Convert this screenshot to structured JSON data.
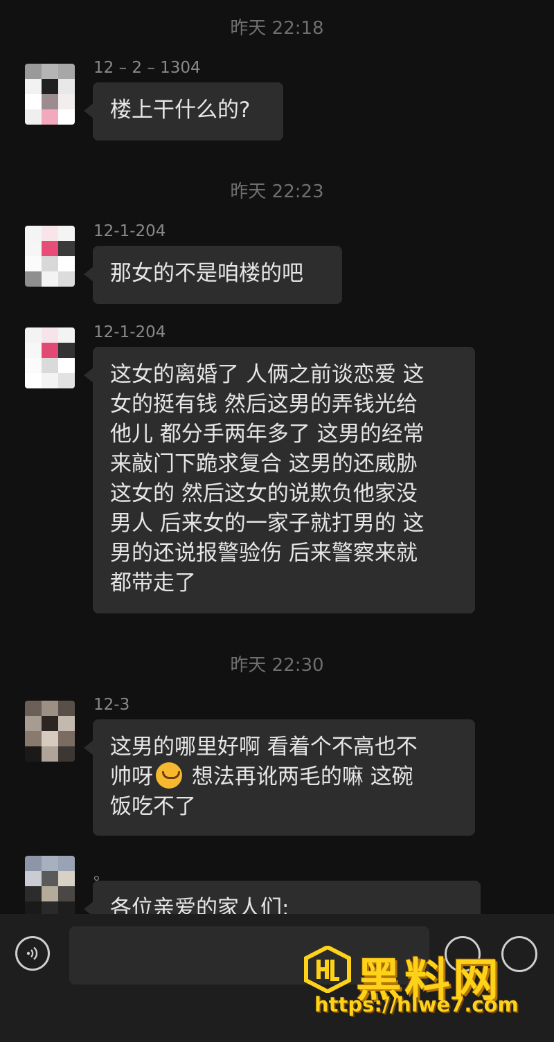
{
  "messages": [
    {
      "timestamp": "昨天 22:18",
      "sender": "12 – 2 – 1304",
      "text": "楼上干什么的?"
    },
    {
      "timestamp": "昨天 22:23",
      "sender": "12-1-204",
      "text": "那女的不是咱楼的吧"
    },
    {
      "sender": "12-1-204",
      "lines": [
        "这女的离婚了 人俩之前谈恋爱 这",
        "女的挺有钱 然后这男的弄钱光给",
        "他儿 都分手两年多了 这男的经常",
        "来敲门下跪求复合 这男的还威胁",
        "这女的 然后这女的说欺负他家没",
        "男人 后来女的一家子就打男的 这",
        "男的还说报警验伤 后来警察来就",
        "都带走了"
      ]
    },
    {
      "timestamp": "昨天 22:30",
      "sender": "12-3",
      "line1": "这男的哪里好啊  看着个不高也不",
      "line2a": "帅呀",
      "line2b": " 想法再讹两毛的嘛   这碗",
      "line3": "饭吃不了"
    },
    {
      "sender": "。",
      "text": "各位亲爱的家人们:"
    }
  ],
  "icons": {
    "emoji": "grimacing-face-emoji",
    "voice": "voice-input-icon",
    "emoji_button": "emoji-icon",
    "plus_button": "plus-icon"
  },
  "watermark": {
    "title": "黑料网",
    "url": "https://hlwe7.com",
    "color": "#ffd21a"
  }
}
